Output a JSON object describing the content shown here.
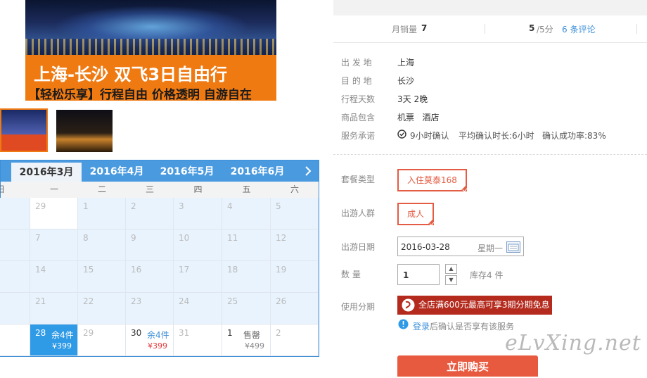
{
  "banner": {
    "title": "上海-长沙  双飞3日自由行",
    "subtitle": "【轻松乐享】行程自由 价格透明 自游自在"
  },
  "calendar": {
    "months": [
      "2016年3月",
      "2016年4月",
      "2016年5月",
      "2016年6月"
    ],
    "active_month": "2016年3月",
    "next_icon": "chevron-right-icon",
    "weekdays": [
      "日",
      "一",
      "二",
      "三",
      "四",
      "五",
      "六"
    ],
    "rows": [
      [
        "",
        "29",
        "1",
        "2",
        "3",
        "4",
        "5"
      ],
      [
        "",
        "7",
        "8",
        "9",
        "10",
        "11",
        "12"
      ],
      [
        "",
        "14",
        "15",
        "16",
        "17",
        "18",
        "19"
      ],
      [
        "",
        "21",
        "22",
        "23",
        "24",
        "25",
        "26"
      ],
      [
        "",
        "28",
        "29",
        "30",
        "31",
        "1",
        "2"
      ]
    ],
    "specials": [
      {
        "row": 4,
        "col": 1,
        "stock": "余4件",
        "price": "¥399",
        "state": "selected"
      },
      {
        "row": 4,
        "col": 3,
        "stock": "余4件",
        "price": "¥399",
        "state": "available"
      },
      {
        "row": 4,
        "col": 5,
        "stock": "售罄",
        "price": "¥499",
        "state": "soldout"
      }
    ]
  },
  "stats": {
    "sales_label": "月销量",
    "sales_value": "7",
    "score_value": "5",
    "score_suffix": "/5分",
    "reviews_link": "6 条评论"
  },
  "info": {
    "departure_label": "出 发 地",
    "departure_value": "上海",
    "destination_label": "目 的 地",
    "destination_value": "长沙",
    "days_label": "行程天数",
    "days_value": "3天 2晚",
    "includes_label": "商品包含",
    "includes_value": "机票   酒店",
    "promise_label": "服务承诺",
    "promise_1": "9小时确认",
    "promise_2": "平均确认时长:6小时",
    "promise_3": "确认成功率:83%"
  },
  "options": {
    "package_label": "套餐类型",
    "package_value": "入住莫泰168",
    "people_label": "出游人群",
    "people_value": "成人",
    "date_label": "出游日期",
    "date_value": "2016-03-28",
    "weekday_value": "星期一",
    "qty_label": "数    量",
    "qty_value": "1",
    "stock_text": "库存4 件",
    "installment_label": "使用分期",
    "installment_promo": "全店满600元最高可享3期分期免息",
    "login_link": "登录",
    "login_note": "后确认是否享有该服务",
    "buy_label": "立即购买"
  },
  "watermark": "eLvXing.net",
  "colors": {
    "accent_orange": "#f07a12",
    "calendar_blue": "#4a9ae0",
    "selected_blue": "#2f9ae6",
    "price_red": "#e4393c",
    "option_red": "#e35c43",
    "promo_red": "#b42b1e",
    "link_blue": "#3d8fd8"
  }
}
